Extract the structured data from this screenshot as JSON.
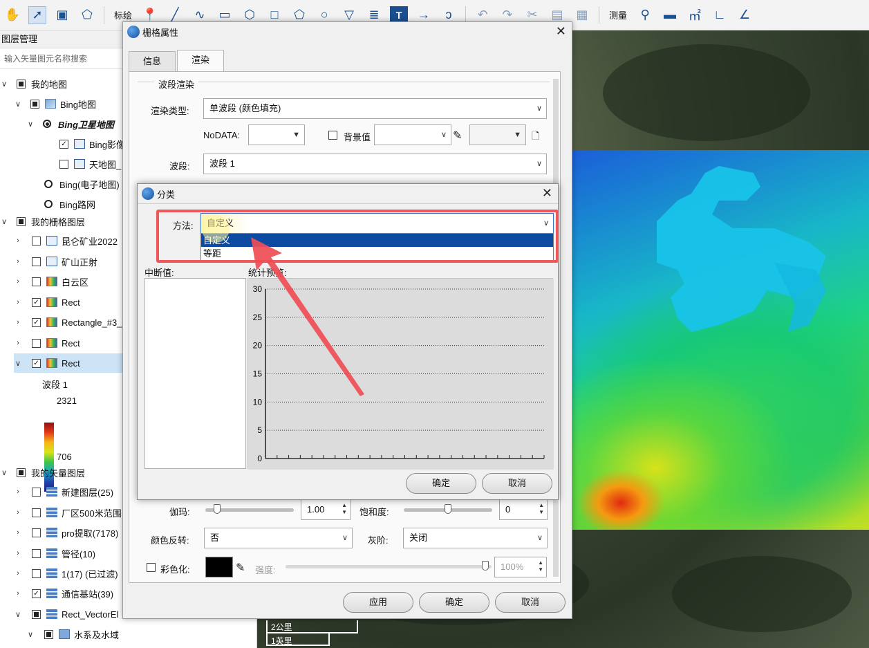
{
  "toolbar": {
    "annotate_label": "标绘",
    "measure_label": "测量",
    "tools": [
      "hand-icon",
      "pointer-icon",
      "select-rect-icon",
      "select-poly-icon"
    ],
    "draw_tools": [
      "marker-icon",
      "line-icon",
      "curve-icon",
      "rect-icon",
      "polygon-icon",
      "square-icon",
      "pentagon-icon",
      "circle-icon",
      "shield-icon",
      "text-underline-icon",
      "text-icon",
      "arrow-icon",
      "freehand-icon"
    ],
    "edit_tools": [
      "undo-icon",
      "redo-icon",
      "cut-icon",
      "copy-icon",
      "paste-icon"
    ],
    "measure_tools": [
      "locate-icon",
      "distance-icon",
      "area-icon",
      "angle-icon",
      "azimuth-icon"
    ]
  },
  "layers_panel": {
    "title": "图层管理",
    "search_placeholder": "输入矢量图元名称搜索",
    "items": [
      {
        "label": "我的地图"
      },
      {
        "label": "Bing地图"
      },
      {
        "label": "Bing卫星地图"
      },
      {
        "label": "Bing影像"
      },
      {
        "label": "天地图_"
      },
      {
        "label": "Bing(电子地图)"
      },
      {
        "label": "Bing路网"
      },
      {
        "label": "我的栅格图层"
      },
      {
        "label": "昆仑矿业2022"
      },
      {
        "label": "矿山正射"
      },
      {
        "label": "白云区"
      },
      {
        "label": "Rect"
      },
      {
        "label": "Rectangle_#3_"
      },
      {
        "label": "Rect"
      },
      {
        "label": "Rect"
      },
      {
        "label": "我的矢量图层"
      },
      {
        "label": "新建图层(25)"
      },
      {
        "label": "厂区500米范围"
      },
      {
        "label": "pro提取(7178)"
      },
      {
        "label": "管径(10)"
      },
      {
        "label": "1(17) (已过滤)"
      },
      {
        "label": "通信基站(39)"
      },
      {
        "label": "Rect_VectorEl"
      },
      {
        "label": "水系及水域"
      }
    ],
    "legend": {
      "band": "波段 1",
      "max": "2321",
      "min": "706"
    }
  },
  "raster_dialog": {
    "title": "栅格属性",
    "tabs": [
      {
        "label": "信息"
      },
      {
        "label": "渲染"
      }
    ],
    "group_title": "波段渲染",
    "render_type_label": "渲染类型:",
    "render_type_value": "单波段 (颜色填充)",
    "nodata_label": "NoDATA:",
    "background_label": "背景值",
    "band_label": "波段:",
    "band_value": "波段 1",
    "gamma_label": "伽玛:",
    "gamma_value": "1.00",
    "saturation_label": "饱和度:",
    "saturation_value": "0",
    "invert_label": "颜色反转:",
    "invert_value": "否",
    "gray_label": "灰阶:",
    "gray_value": "关闭",
    "colorize_label": "彩色化:",
    "strength_label": "强度:",
    "strength_value": "100%",
    "apply": "应用",
    "ok": "确定",
    "cancel": "取消"
  },
  "classify_dialog": {
    "title": "分类",
    "method_label": "方法:",
    "method_value": "自定义",
    "method_options": [
      "自定义",
      "等距"
    ],
    "breaks_label": "中断值:",
    "stats_label": "统计预览:",
    "ok": "确定",
    "cancel": "取消"
  },
  "chart_data": {
    "type": "bar",
    "title": "",
    "xlabel": "",
    "ylabel": "",
    "ylim": [
      0,
      30
    ],
    "yticks": [
      0,
      5,
      10,
      15,
      20,
      25,
      30
    ],
    "values": []
  },
  "map": {
    "scale_km": "2公里",
    "scale_mi": "1英里"
  },
  "colors": {
    "accent": "#0d4aa1",
    "annotation": "#f0575a"
  }
}
